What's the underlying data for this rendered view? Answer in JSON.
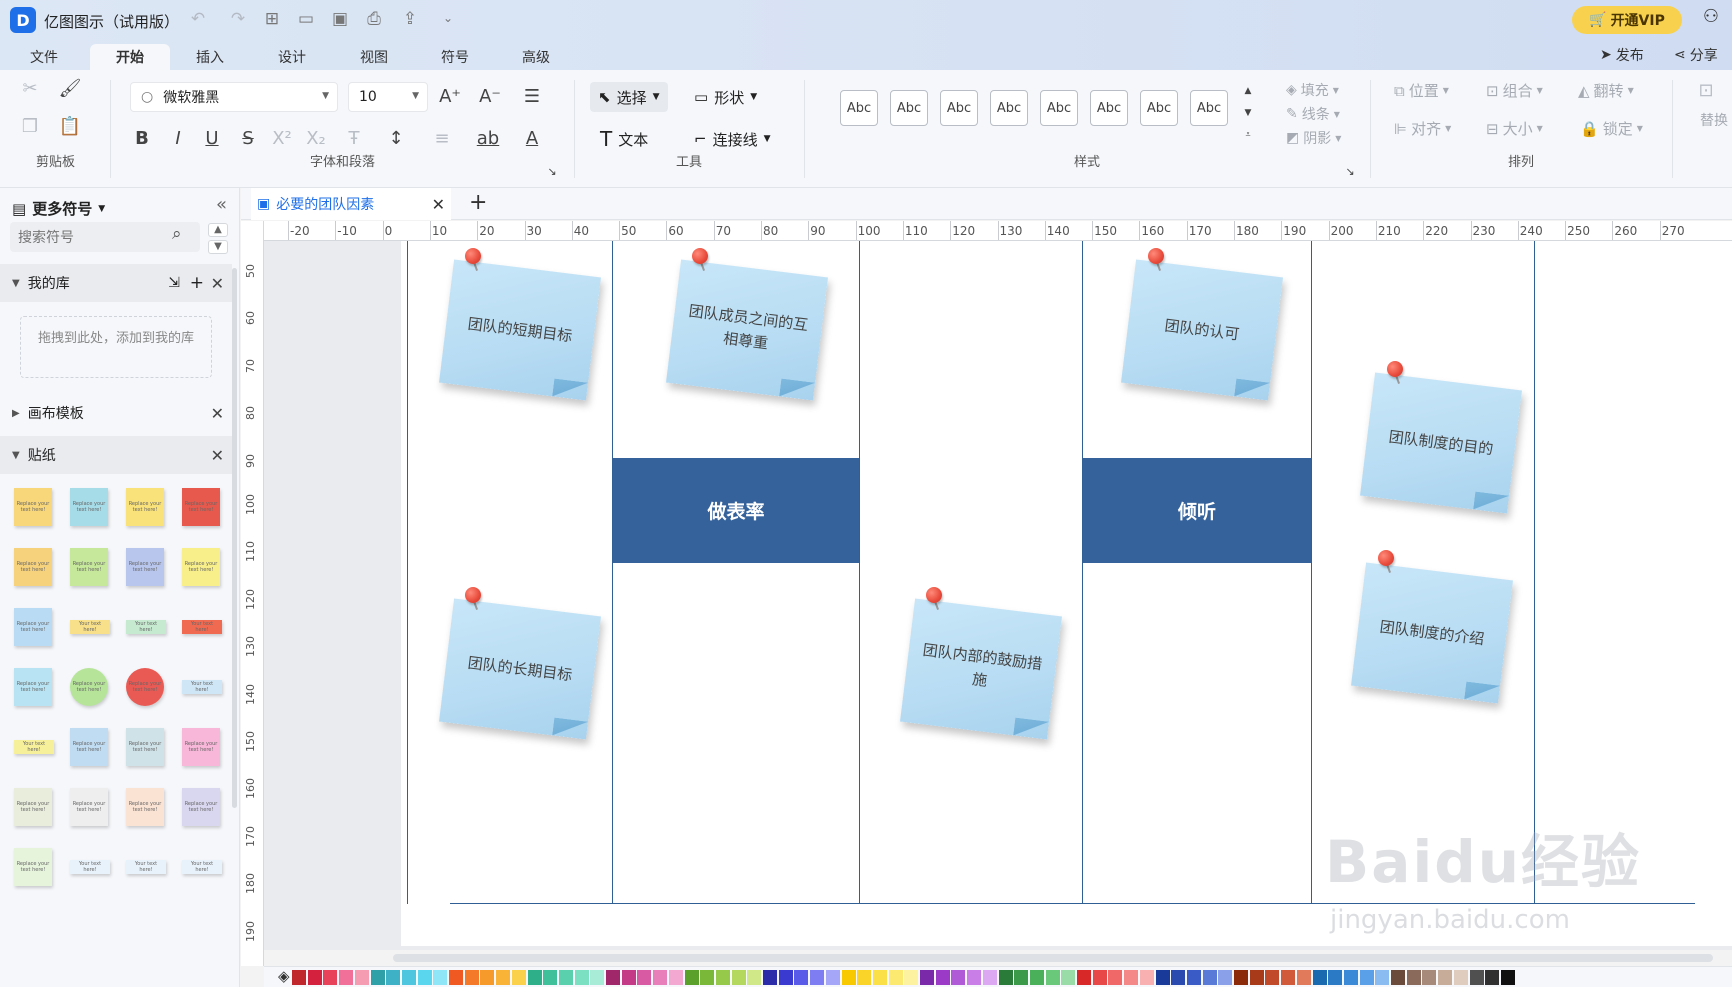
{
  "app": {
    "title": "亿图图示（试用版）",
    "logo_letter": "D"
  },
  "titlebar": {
    "vip_label": "开通VIP"
  },
  "menu": {
    "tabs": [
      "文件",
      "开始",
      "插入",
      "设计",
      "视图",
      "符号",
      "高级"
    ],
    "active": "开始",
    "publish": "发布",
    "share": "分享"
  },
  "ribbon": {
    "font_name": "微软雅黑",
    "font_size": "10",
    "groups": {
      "clipboard": "剪贴板",
      "font": "字体和段落",
      "tools": "工具",
      "style": "样式",
      "arrange": "排列"
    },
    "select_label": "选择",
    "shape_label": "形状",
    "text_label": "文本",
    "connector_label": "连接线",
    "style_sample": "Abc",
    "fill_label": "填充",
    "line_label": "线条",
    "shadow_label": "阴影",
    "position_label": "位置",
    "group_label": "组合",
    "flip_label": "翻转",
    "align_label": "对齐",
    "size_label": "大小",
    "lock_label": "锁定",
    "replace_label": "替换"
  },
  "sidebar": {
    "title": "更多符号",
    "search_placeholder": "搜索符号",
    "my_library": "我的库",
    "dropzone_text": "拖拽到此处，添加到我的库",
    "canvas_template": "画布模板",
    "stickers": "贴纸",
    "sticker_sample": "Replace your text here!",
    "sticker_sample_short": "Your text here!"
  },
  "document": {
    "tab_name": "必要的团队因素"
  },
  "rulers": {
    "h_ticks": [
      "-20",
      "-10",
      "0",
      "10",
      "20",
      "30",
      "40",
      "50",
      "60",
      "70",
      "80",
      "90",
      "100",
      "110",
      "120",
      "130",
      "140",
      "150",
      "160",
      "170",
      "180",
      "190",
      "200",
      "210",
      "220",
      "230",
      "240",
      "250",
      "260",
      "270"
    ],
    "v_ticks": [
      "50",
      "60",
      "70",
      "80",
      "90",
      "100",
      "110",
      "120",
      "130",
      "140",
      "150",
      "160",
      "170",
      "180",
      "190"
    ]
  },
  "diagram": {
    "bands": [
      "做表率",
      "倾听"
    ],
    "notes": [
      "团队的短期目标",
      "团队成员之间的互相尊重",
      "团队的认可",
      "团队制度的目的",
      "团队的长期目标",
      "团队内部的鼓励措施",
      "团队制度的介绍"
    ],
    "line_color": "#2f5f95",
    "band_color": "#35629b",
    "note_color": "#b7dcf3",
    "pin_color": "#e84a3a"
  },
  "watermark": {
    "brand": "Baidu经验",
    "url": "jingyan.baidu.com"
  }
}
